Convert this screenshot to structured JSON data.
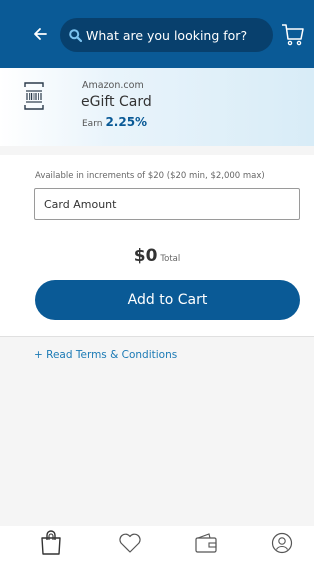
{
  "header": {
    "search_placeholder": "What are you looking for?",
    "icons": [
      "back-arrow-icon",
      "search-icon",
      "cart-icon"
    ]
  },
  "product": {
    "merchant": "Amazon.com",
    "name": "eGift Card",
    "earn_label": "Earn",
    "earn_value": "2.25%",
    "icon": "gift-card-icon"
  },
  "purchase": {
    "hint": "Available in increments of $20 ($20 min, $2,000 max)",
    "amount_placeholder": "Card Amount",
    "total_value": "$0",
    "total_label": "Total",
    "add_to_cart_label": "Add to Cart",
    "terms_label": "+ Read Terms & Conditions"
  },
  "bottom_nav": {
    "items": [
      {
        "icon": "shopping-bag-icon",
        "active": true
      },
      {
        "icon": "heart-icon",
        "active": false
      },
      {
        "icon": "wallet-icon",
        "active": false
      },
      {
        "icon": "account-icon",
        "active": false
      }
    ]
  },
  "colors": {
    "brand_blue": "#0a5a96",
    "search_bg": "#08406d",
    "link_blue": "#1b7ab5",
    "banner_tint": "#d8ecf7"
  }
}
